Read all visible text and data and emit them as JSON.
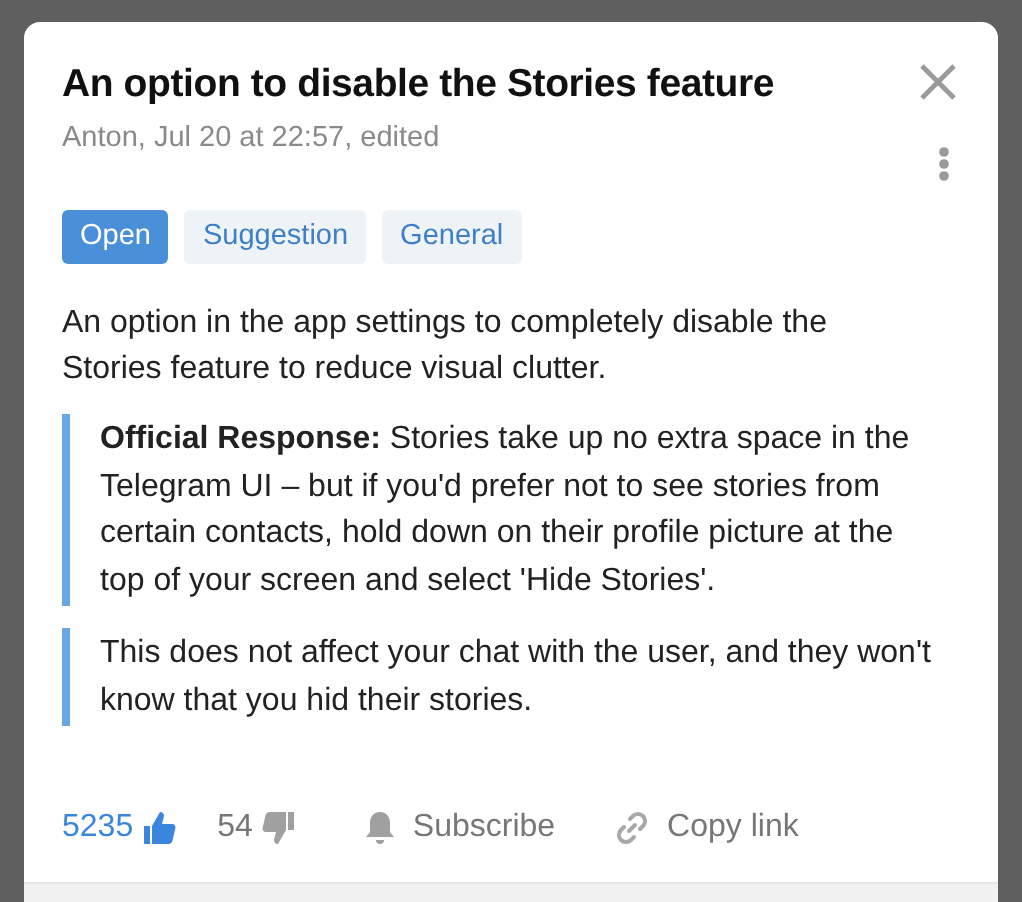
{
  "title": "An option to disable the Stories feature",
  "meta": "Anton, Jul 20 at 22:57, edited",
  "tags": [
    {
      "label": "Open",
      "kind": "status"
    },
    {
      "label": "Suggestion",
      "kind": "category"
    },
    {
      "label": "General",
      "kind": "category"
    }
  ],
  "description": "An option in the app settings to completely disable the Stories feature to reduce visual clutter.",
  "responses": [
    {
      "text": "**Official Response:** Stories take up no extra space in the Telegram UI – but if you'd prefer not to see stories from certain contacts, hold down on their profile picture at the top of your screen and select 'Hide Stories'."
    },
    {
      "text": "This does not affect your chat with the user, and they won't know that you hid their stories."
    }
  ],
  "votes": [
    {
      "kind": "up",
      "count": "5235",
      "selected": true
    },
    {
      "kind": "down",
      "count": "54",
      "selected": false
    }
  ],
  "actions": [
    {
      "kind": "subscribe",
      "label": "Subscribe"
    },
    {
      "kind": "copy",
      "label": "Copy link"
    }
  ]
}
